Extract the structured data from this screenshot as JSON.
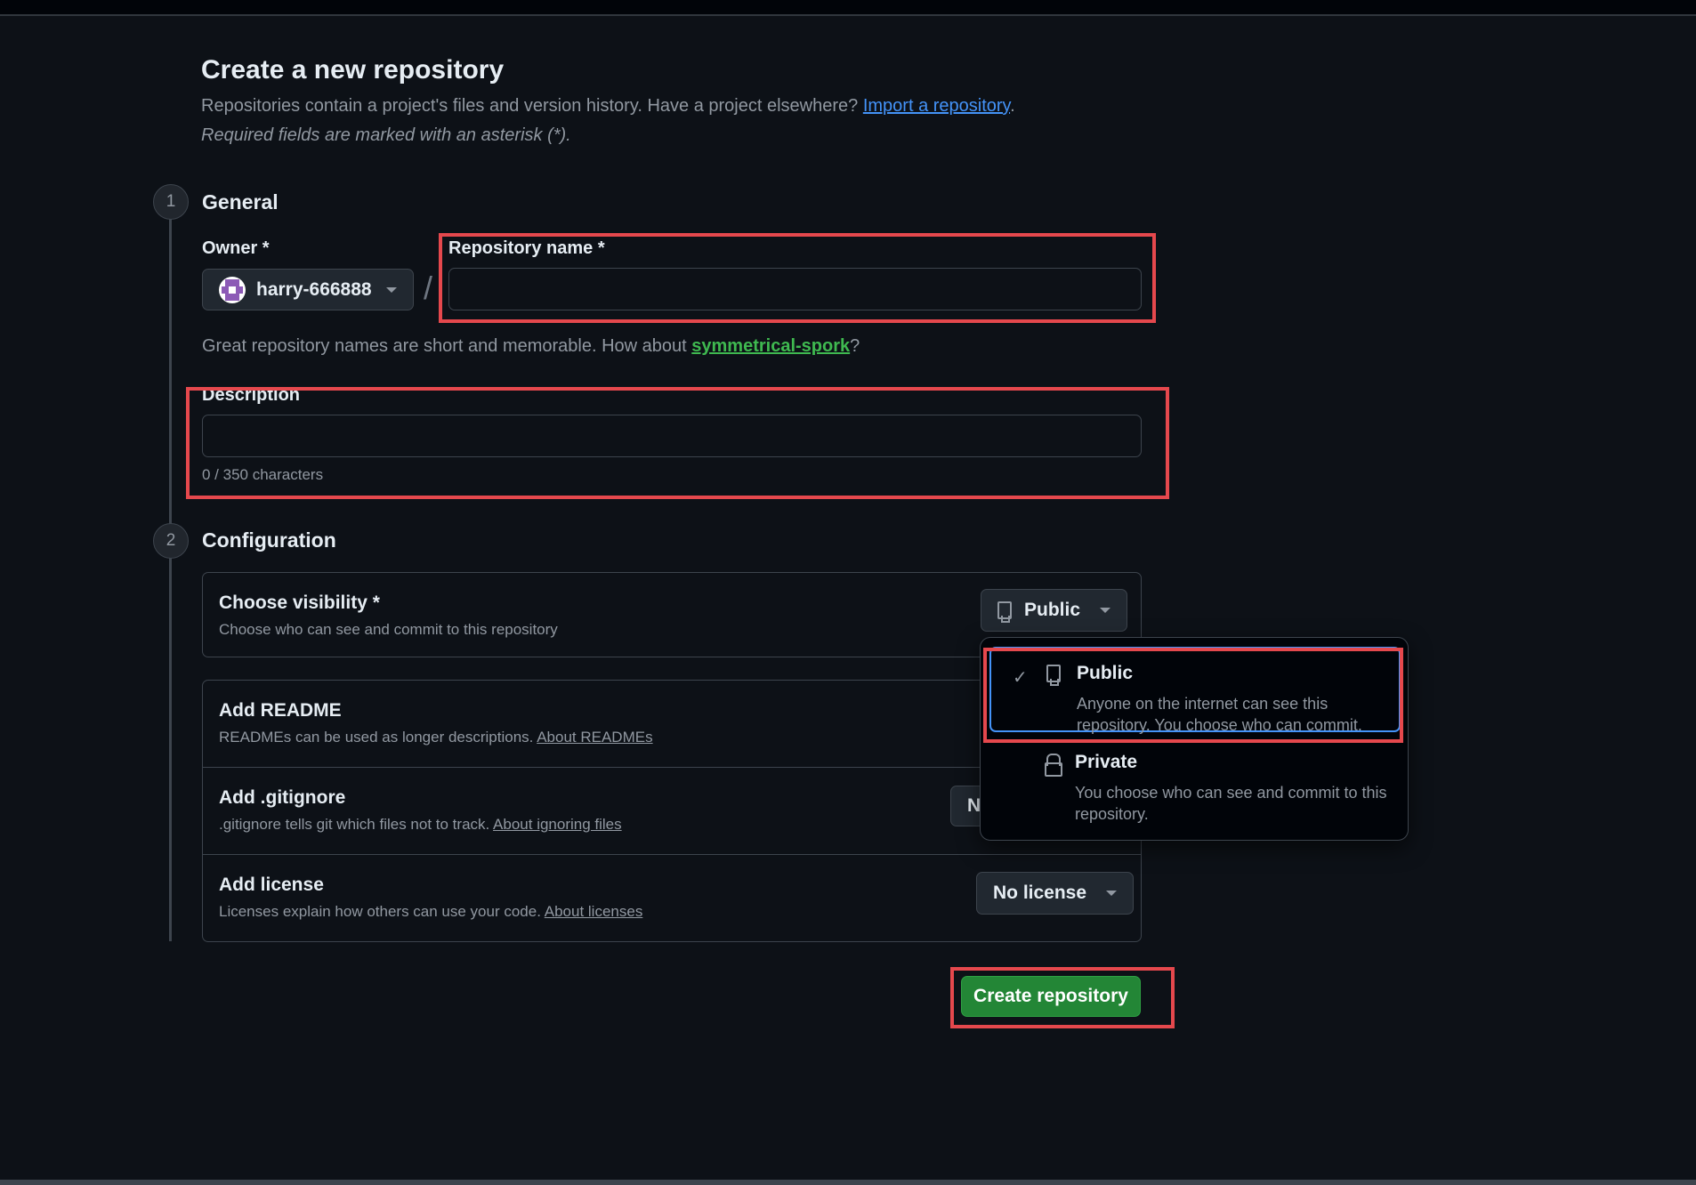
{
  "page": {
    "title": "Create a new repository",
    "intro_text": "Repositories contain a project's files and version history. Have a project elsewhere?",
    "import_link": "Import a repository",
    "intro_end": ".",
    "required_note": "Required fields are marked with an asterisk (*)."
  },
  "general": {
    "step": "1",
    "title": "General",
    "owner_label": "Owner *",
    "owner_name": "harry-666888",
    "slash": "/",
    "repo_name_label": "Repository name *",
    "repo_name_value": "",
    "hint_text": "Great repository names are short and memorable. How about",
    "hint_suggestion": "symmetrical-spork",
    "hint_end": "?",
    "description_label": "Description",
    "description_value": "",
    "char_count": "0 / 350 characters"
  },
  "configuration": {
    "step": "2",
    "title": "Configuration",
    "visibility_title": "Choose visibility *",
    "visibility_desc": "Choose who can see and commit to this repository",
    "visibility_value": "Public",
    "readme_title": "Add README",
    "readme_desc": "READMEs can be used as longer descriptions.",
    "readme_link": "About READMEs",
    "gitignore_title": "Add .gitignore",
    "gitignore_desc": ".gitignore tells git which files not to track.",
    "gitignore_link": "About ignoring files",
    "gitignore_value_partial": "N",
    "license_title": "Add license",
    "license_desc": "Licenses explain how others can use your code.",
    "license_link": "About licenses",
    "license_value": "No license"
  },
  "visibility_menu": {
    "check": "✓",
    "items": [
      {
        "title": "Public",
        "desc": "Anyone on the internet can see this repository. You choose who can commit."
      },
      {
        "title": "Private",
        "desc": "You choose who can see and commit to this repository."
      }
    ]
  },
  "actions": {
    "create_label": "Create repository"
  },
  "colors": {
    "background": "#0d1117",
    "accent": "#4493f8",
    "success": "#238636",
    "annotation": "#e5484d"
  }
}
